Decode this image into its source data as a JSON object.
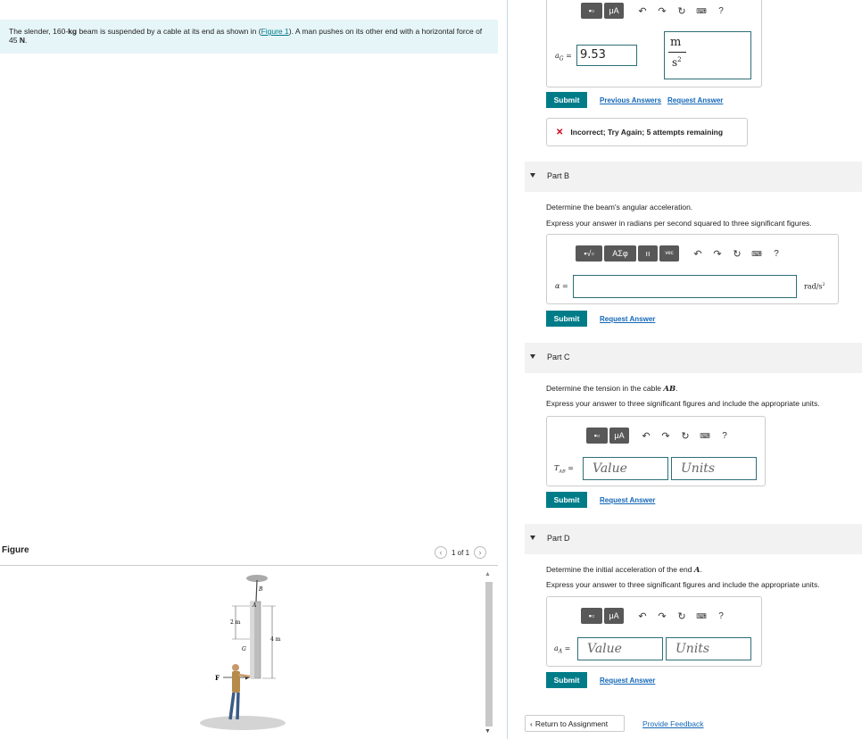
{
  "problem": {
    "text_before": "The slender, 160-",
    "kg": "kg",
    "text_mid": " beam is suspended by a cable at its end as shown in (",
    "figure_link": "Figure 1",
    "text_after": "). A man pushes on its other end with a horizontal force of 45 ",
    "unit_N": "N",
    "period": "."
  },
  "figure": {
    "label": "Figure",
    "pager": "1 of 1",
    "labels": {
      "A": "A",
      "B": "B",
      "G": "G",
      "F": "F",
      "dim_2m": "2 m",
      "dim_4m": "4 m"
    }
  },
  "part_a": {
    "var": "a",
    "var_sub": "G",
    "eq": "=",
    "value": "9.53",
    "unit_num": "m",
    "unit_den": "s",
    "unit_exp": "2",
    "submit": "Submit",
    "prev_answers": "Previous Answers",
    "request_answer": "Request Answer",
    "feedback_icon": "✕",
    "feedback": "Incorrect; Try Again; 5 attempts remaining"
  },
  "part_b": {
    "label": "Part B",
    "question": "Determine the beam's angular acceleration.",
    "instruction": "Express your answer in radians per second squared to three significant figures.",
    "var": "α",
    "eq": "=",
    "unit": "rad/s",
    "unit_exp": "2",
    "submit": "Submit",
    "request_answer": "Request Answer"
  },
  "part_c": {
    "label": "Part C",
    "question_prefix": "Determine the tension in the cable ",
    "question_var": "AB",
    "question_suffix": ".",
    "instruction": "Express your answer to three significant figures and include the appropriate units.",
    "var": "T",
    "var_sub": "AB",
    "eq": "=",
    "value_placeholder": "Value",
    "units_placeholder": "Units",
    "submit": "Submit",
    "request_answer": "Request Answer"
  },
  "part_d": {
    "label": "Part D",
    "question_prefix": "Determine the initial acceleration of the end ",
    "question_var": "A",
    "question_suffix": ".",
    "instruction": "Express your answer to three significant figures and include the appropriate units.",
    "var": "a",
    "var_sub": "A",
    "eq": "=",
    "value_placeholder": "Value",
    "units_placeholder": "Units",
    "submit": "Submit",
    "request_answer": "Request Answer"
  },
  "toolbar": {
    "greek": "ΑΣφ",
    "vec": "vec",
    "mu_a": "μA",
    "help": "?",
    "undo_icon": "↶",
    "redo_icon": "↷",
    "reset_icon": "↻"
  },
  "footer": {
    "return": "Return to Assignment",
    "feedback": "Provide Feedback"
  }
}
